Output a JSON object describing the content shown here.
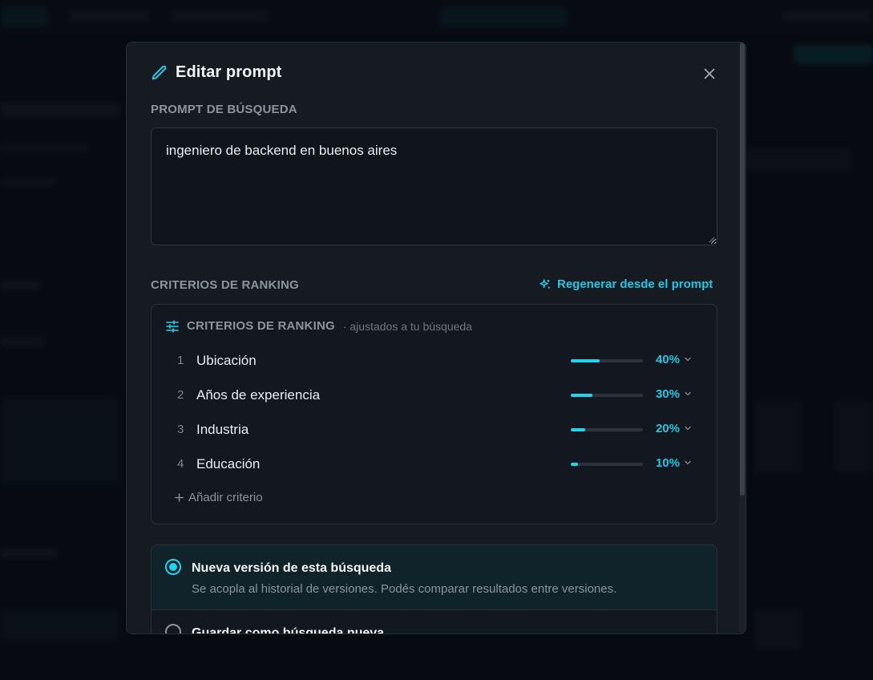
{
  "colors": {
    "accent": "#22d3ee",
    "accent_text": "#22c7e6",
    "modal_bg": "#161b22",
    "muted": "#8b949e"
  },
  "modal": {
    "title": "Editar prompt",
    "title_icon": "pencil-icon",
    "close_icon": "close-icon",
    "prompt_section_label": "PROMPT DE BÚSQUEDA",
    "prompt_value": "ingeniero de backend en buenos aires",
    "ranking_section_label": "CRITERIOS DE RANKING",
    "regenerate_label": "Regenerar desde el prompt",
    "regenerate_icon": "sparkles-icon"
  },
  "criteria": {
    "header_icon": "sliders-icon",
    "title": "CRITERIOS DE RANKING",
    "subtitle": "· ajustados a tu búsqueda",
    "items": [
      {
        "index": "1",
        "name": "Ubicación",
        "weight": 40,
        "weight_label": "40%"
      },
      {
        "index": "2",
        "name": "Años de experiencia",
        "weight": 30,
        "weight_label": "30%"
      },
      {
        "index": "3",
        "name": "Industria",
        "weight": 20,
        "weight_label": "20%"
      },
      {
        "index": "4",
        "name": "Educación",
        "weight": 10,
        "weight_label": "10%"
      }
    ],
    "add_label": "Añadir criterio"
  },
  "save_options": {
    "selected": "new_version",
    "new_version": {
      "title": "Nueva versión de esta búsqueda",
      "description": "Se acopla al historial de versiones. Podés comparar resultados entre versiones."
    },
    "new_search": {
      "title": "Guardar como búsqueda nueva"
    }
  }
}
